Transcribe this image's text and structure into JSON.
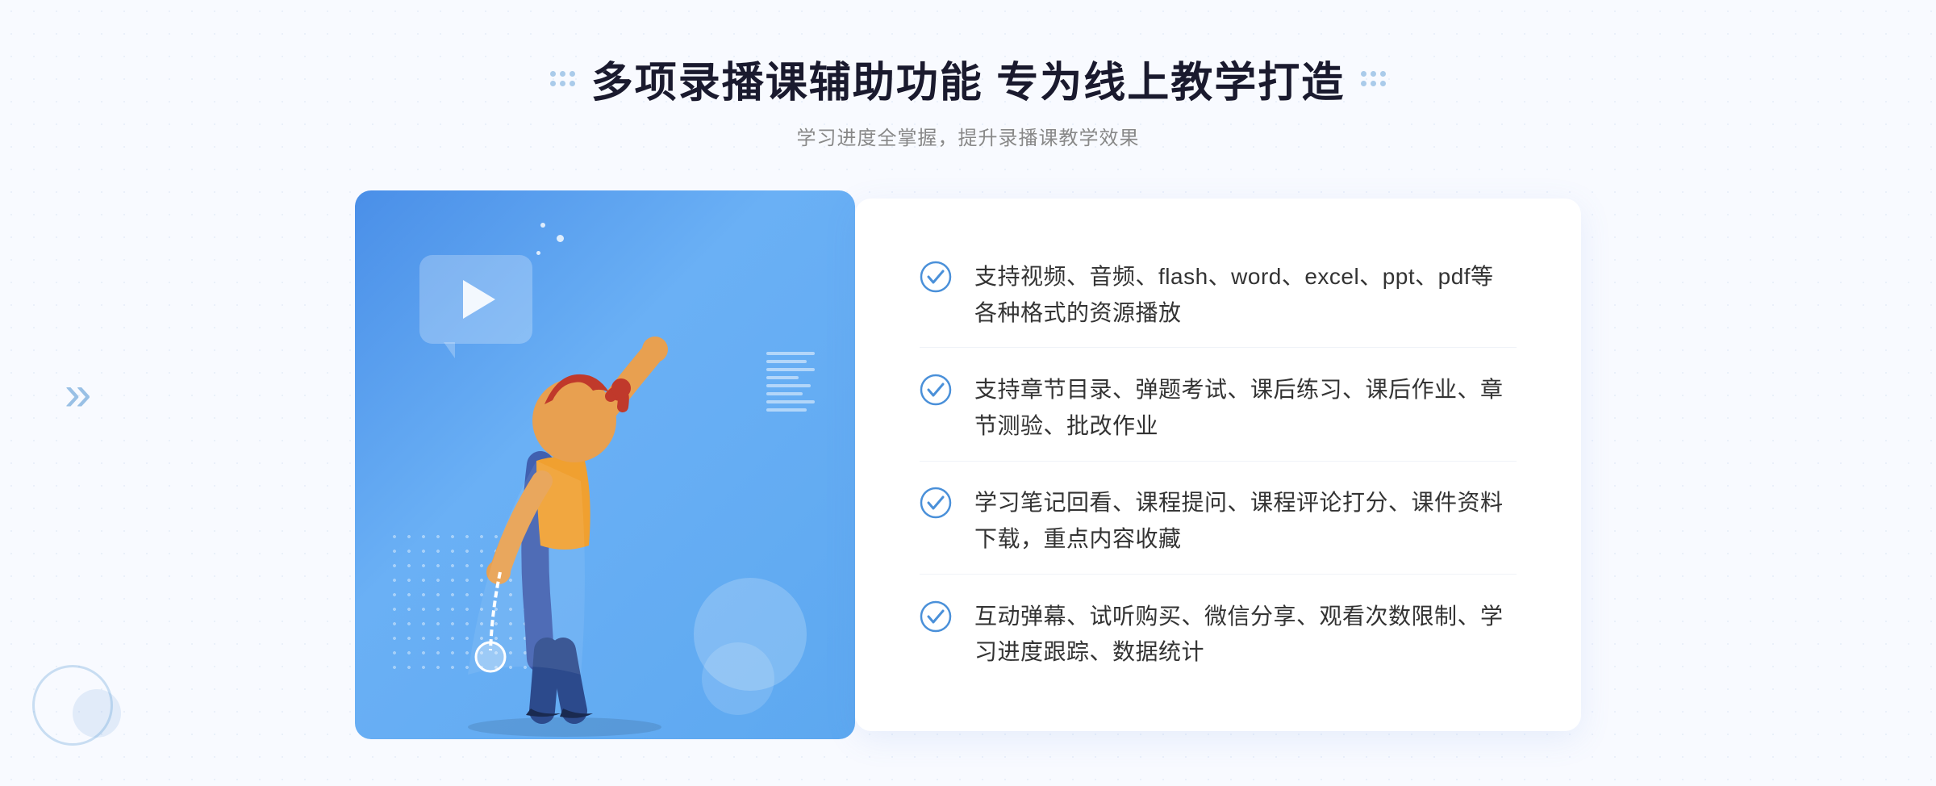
{
  "header": {
    "title": "多项录播课辅助功能 专为线上教学打造",
    "subtitle": "学习进度全掌握，提升录播课教学效果"
  },
  "features": [
    {
      "id": 1,
      "text": "支持视频、音频、flash、word、excel、ppt、pdf等各种格式的资源播放"
    },
    {
      "id": 2,
      "text": "支持章节目录、弹题考试、课后练习、课后作业、章节测验、批改作业"
    },
    {
      "id": 3,
      "text": "学习笔记回看、课程提问、课程评论打分、课件资料下载，重点内容收藏"
    },
    {
      "id": 4,
      "text": "互动弹幕、试听购买、微信分享、观看次数限制、学习进度跟踪、数据统计"
    }
  ],
  "colors": {
    "primary_blue": "#4a8fe8",
    "light_blue": "#6ab0f5",
    "check_blue": "#4a90d9",
    "text_dark": "#1a1a2e",
    "text_gray": "#888888",
    "text_feature": "#333333"
  },
  "decorative": {
    "left_chevron": "»",
    "play_label": "play-icon"
  }
}
